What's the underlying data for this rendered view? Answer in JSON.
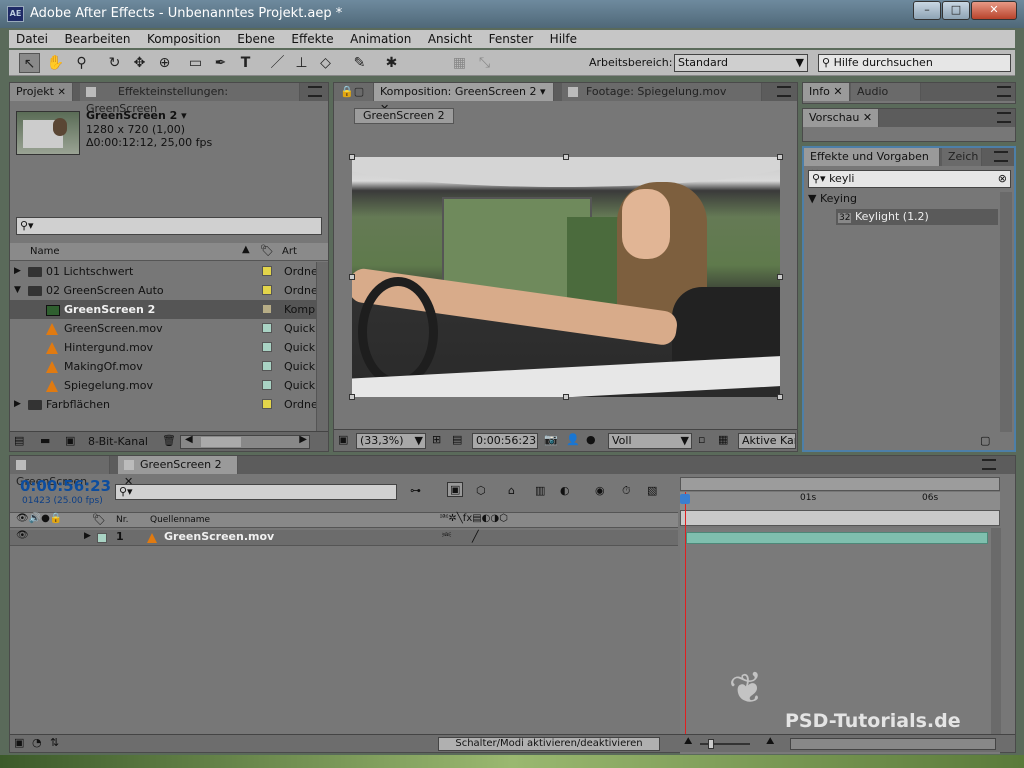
{
  "window": {
    "title": "Adobe After Effects - Unbenanntes Projekt.aep *",
    "app_icon": "AE",
    "controls": [
      "–",
      "□",
      "✕"
    ]
  },
  "menu": [
    "Datei",
    "Bearbeiten",
    "Komposition",
    "Ebene",
    "Effekte",
    "Animation",
    "Ansicht",
    "Fenster",
    "Hilfe"
  ],
  "toolbar": {
    "workspace_label": "Arbeitsbereich:",
    "workspace_value": "Standard",
    "help_placeholder": "Hilfe durchsuchen",
    "tools": [
      "selection-tool-icon",
      "hand-tool-icon",
      "zoom-tool-icon",
      "rotate-tool-icon",
      "camera-orbit-icon",
      "pan-behind-icon",
      "rectangle-tool-icon",
      "pen-tool-icon",
      "text-tool-icon",
      "brush-tool-icon",
      "clone-stamp-icon",
      "eraser-icon",
      "roto-brush-icon",
      "puppet-pin-icon"
    ]
  },
  "project": {
    "tab": "Projekt",
    "tab2": "Effekteinstellungen: GreenScreen",
    "item_name": "GreenScreen 2 ▾",
    "item_res": "1280 x 720 (1,00)",
    "item_dur": "Δ0:00:12:12, 25,00 fps",
    "search": "⚲▾",
    "col_name": "Name",
    "col_type": "Art",
    "rows": [
      {
        "name": "01 Lichtschwert",
        "type": "Ordne",
        "kind": "folder",
        "twirl": "▶",
        "indent": 0,
        "color": "#e3d54a"
      },
      {
        "name": "02 GreenScreen Auto",
        "type": "Ordne",
        "kind": "folder",
        "twirl": "▼",
        "indent": 0,
        "color": "#e3d54a"
      },
      {
        "name": "GreenScreen 2",
        "type": "Komp",
        "kind": "comp",
        "twirl": "",
        "indent": 1,
        "color": "#b7ad86",
        "selected": true
      },
      {
        "name": "GreenScreen.mov",
        "type": "Quick",
        "kind": "movie",
        "twirl": "",
        "indent": 1,
        "color": "#a9d3c4"
      },
      {
        "name": "Hintergund.mov",
        "type": "Quick",
        "kind": "movie",
        "twirl": "",
        "indent": 1,
        "color": "#a9d3c4"
      },
      {
        "name": "MakingOf.mov",
        "type": "Quick",
        "kind": "movie",
        "twirl": "",
        "indent": 1,
        "color": "#a9d3c4"
      },
      {
        "name": "Spiegelung.mov",
        "type": "Quick",
        "kind": "movie",
        "twirl": "",
        "indent": 1,
        "color": "#a9d3c4"
      },
      {
        "name": "Farbflächen",
        "type": "Ordne",
        "kind": "folder",
        "twirl": "▶",
        "indent": 0,
        "color": "#e3d54a"
      }
    ],
    "bitdepth": "8-Bit-Kanal"
  },
  "comp": {
    "tab": "Komposition: GreenScreen 2",
    "tab2": "Footage: Spiegelung.mov",
    "breadcrumb": "GreenScreen 2",
    "zoom": "(33,3%)",
    "timecode": "0:00:56:23",
    "resolution": "Voll",
    "camera": "Aktive Kar"
  },
  "right": {
    "info_tab": "Info",
    "audio_tab": "Audio",
    "preview_tab": "Vorschau",
    "effects_tab": "Effekte und Vorgaben",
    "char_tab": "Zeich",
    "search": "keyli",
    "category": "Keying",
    "effect": "Keylight (1.2)"
  },
  "timeline": {
    "tab1": "GreenScreen",
    "tab2": "GreenScreen 2",
    "timecode": "0:00:56:23",
    "frame": "01423 (25.00 fps)",
    "search": "⚲▾",
    "col_nr": "Nr.",
    "col_source": "Quellenname",
    "layer_nr": "1",
    "layer_name": "GreenScreen.mov",
    "ruler": [
      "01s",
      "06s"
    ],
    "toggle": "Schalter/Modi aktivieren/deaktivieren"
  },
  "watermark": "PSD-Tutorials.de"
}
